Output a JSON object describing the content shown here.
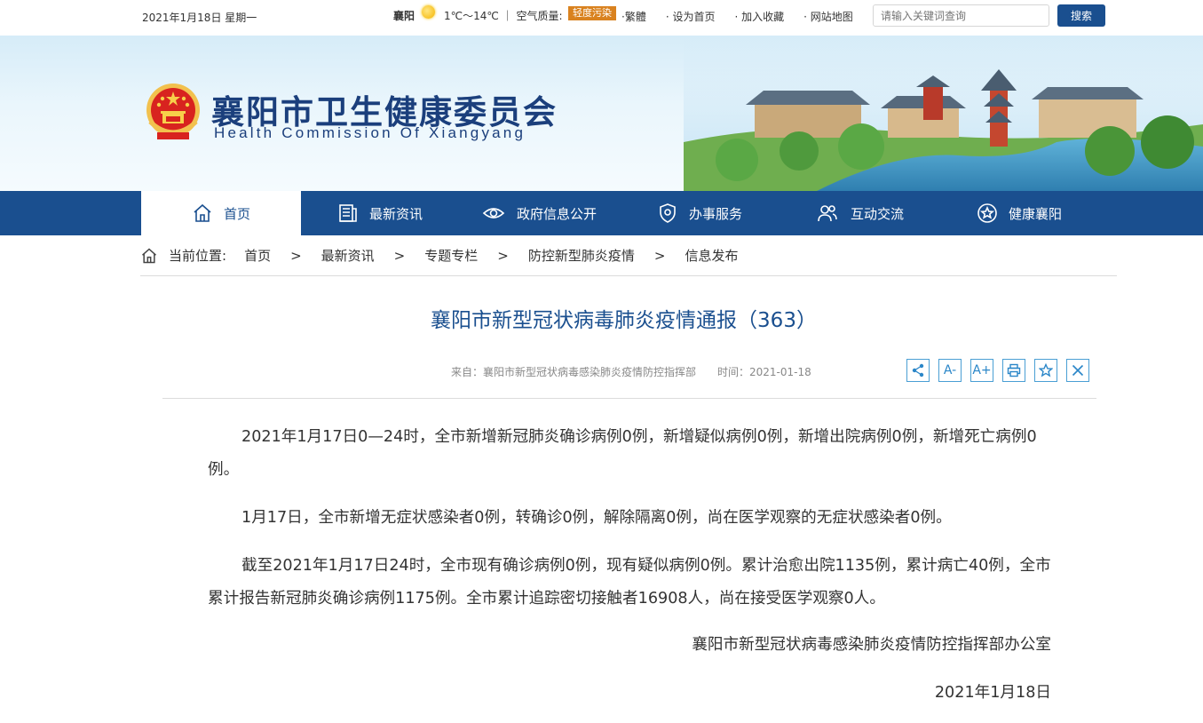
{
  "topbar": {
    "date": "2021年1月18日 星期一",
    "city": "襄阳",
    "weather_icon": "sun-icon",
    "temperature": "1℃～14℃ ｜ 空气质量:",
    "air_quality": "轻度污染",
    "links": [
      "·繁體",
      "· 设为首页",
      "· 加入收藏",
      "· 网站地图"
    ],
    "search_placeholder": "请输入关键词查询",
    "search_button": "搜索"
  },
  "header": {
    "title": "襄阳市卫生健康委员会",
    "subtitle": "Health Commission Of Xiangyang"
  },
  "nav": {
    "items": [
      {
        "label": "首页",
        "icon": "home-icon"
      },
      {
        "label": "最新资讯",
        "icon": "news-icon"
      },
      {
        "label": "政府信息公开",
        "icon": "eye-icon"
      },
      {
        "label": "办事服务",
        "icon": "shield-icon"
      },
      {
        "label": "互动交流",
        "icon": "people-icon"
      },
      {
        "label": "健康襄阳",
        "icon": "star-icon"
      }
    ]
  },
  "breadcrumb": {
    "prefix": "当前位置:",
    "items": [
      "首页",
      "最新资讯",
      "专题专栏",
      "防控新型肺炎疫情",
      "信息发布"
    ],
    "separator": ">"
  },
  "article": {
    "title": "襄阳市新型冠状病毒肺炎疫情通报（363）",
    "source": "来自：襄阳市新型冠状病毒感染肺炎疫情防控指挥部",
    "time": "时间：2021-01-18",
    "tools": [
      "share-icon",
      "font-smaller-icon",
      "font-larger-icon",
      "print-icon",
      "favorite-icon",
      "close-icon"
    ],
    "tool_labels": [
      "A-",
      "A+"
    ],
    "paragraphs": [
      "2021年1月17日0—24时，全市新增新冠肺炎确诊病例0例，新增疑似病例0例，新增出院病例0例，新增死亡病例0例。",
      "1月17日，全市新增无症状感染者0例，转确诊0例，解除隔离0例，尚在医学观察的无症状感染者0例。",
      "截至2021年1月17日24时，全市现有确诊病例0例，现有疑似病例0例。累计治愈出院1135例，累计病亡40例，全市累计报告新冠肺炎确诊病例1175例。全市累计追踪密切接触者16908人，尚在接受医学观察0人。"
    ],
    "signature": "襄阳市新型冠状病毒感染肺炎疫情防控指挥部办公室",
    "date": "2021年1月18日"
  },
  "colors": {
    "primary": "#1a4f8f",
    "accent": "#d9821f",
    "tool_border": "#4a9fd4"
  }
}
